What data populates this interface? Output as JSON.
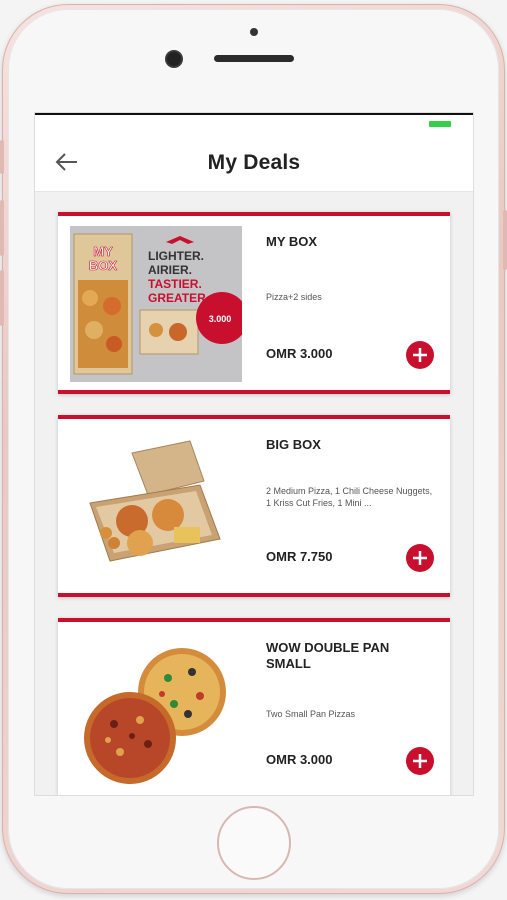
{
  "header": {
    "title": "My Deals",
    "back_icon": "arrow-left-icon"
  },
  "status_bar": {
    "battery_color": "#35d04b"
  },
  "brand": {
    "accent": "#c8102e"
  },
  "deals": [
    {
      "name": "MY BOX",
      "description": "Pizza+2 sides",
      "price": "OMR 3.000",
      "promo": {
        "box_logo_top": "MY",
        "box_logo_bottom": "BOX",
        "lines": [
          "LIGHTER.",
          "AIRIER.",
          "TASTIER.",
          "GREATER."
        ],
        "badge": "3.000"
      }
    },
    {
      "name": "BIG BOX",
      "description": "2 Medium Pizza, 1 Chili Cheese Nuggets, 1 Kriss Cut Fries, 1 Mini ...",
      "price": "OMR 7.750"
    },
    {
      "name": "WOW DOUBLE PAN SMALL",
      "description": "Two Small Pan Pizzas",
      "price": "OMR 3.000"
    }
  ]
}
